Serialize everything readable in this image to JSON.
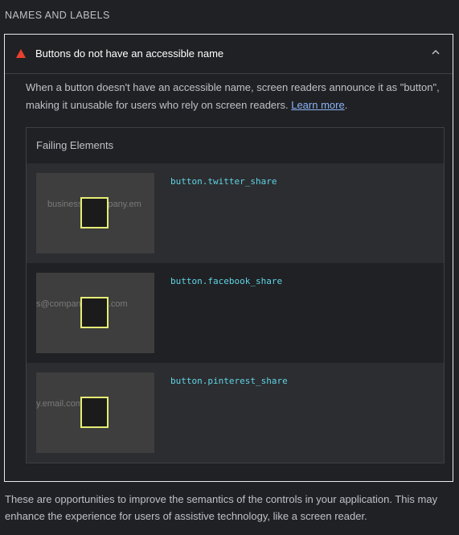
{
  "section": {
    "title": "NAMES AND LABELS"
  },
  "audit": {
    "title": "Buttons do not have an accessible name",
    "description": "When a button doesn't have an accessible name, screen readers announce it as \"button\", making it unusable for users who rely on screen readers. ",
    "learn_more": "Learn more",
    "trailing": ".",
    "status_icon": "fail-triangle-icon",
    "status_color": "#e8412f",
    "expanded_icon": "chevron-up-icon"
  },
  "failing": {
    "header": "Failing Elements",
    "items": [
      {
        "thumb_text": "business@company.em",
        "selector": "button.twitter_share"
      },
      {
        "thumb_text": "s@company.email.com",
        "selector": "button.facebook_share"
      },
      {
        "thumb_text": "y.email.com",
        "selector": "button.pinterest_share"
      }
    ]
  },
  "footer": {
    "text": "These are opportunities to improve the semantics of the controls in your application. This may enhance the experience for users of assistive technology, like a screen reader."
  },
  "colors": {
    "highlight": "#e6ed75",
    "selector": "#5fd4e6",
    "link": "#8ab4f8"
  }
}
